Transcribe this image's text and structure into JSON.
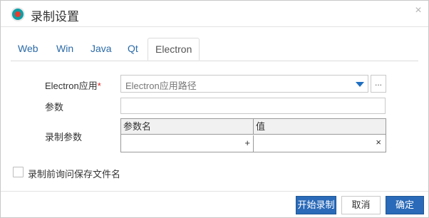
{
  "dialog": {
    "title": "录制设置",
    "close_glyph": "×",
    "icon": "record-icon"
  },
  "tabs": [
    {
      "label": "Web"
    },
    {
      "label": "Win"
    },
    {
      "label": "Java"
    },
    {
      "label": "Qt"
    },
    {
      "label": "Electron",
      "active": true
    }
  ],
  "form": {
    "app_label": "Electron应用",
    "required_mark": "*",
    "app_path_value": "Electron应用路径",
    "browse_label": "...",
    "params_label": "参数",
    "params_value": "",
    "record_params_label": "录制参数",
    "grid": {
      "columns": [
        "参数名",
        "值"
      ],
      "add_glyph": "+",
      "delete_glyph": "×"
    }
  },
  "checkbox": {
    "label": "录制前询问保存文件名",
    "checked": false
  },
  "buttons": {
    "start": "开始录制",
    "cancel": "取消",
    "ok": "确定"
  },
  "colors": {
    "accent": "#2a6ab8",
    "tab_link": "#2a6aa8",
    "required": "#d9221c"
  }
}
